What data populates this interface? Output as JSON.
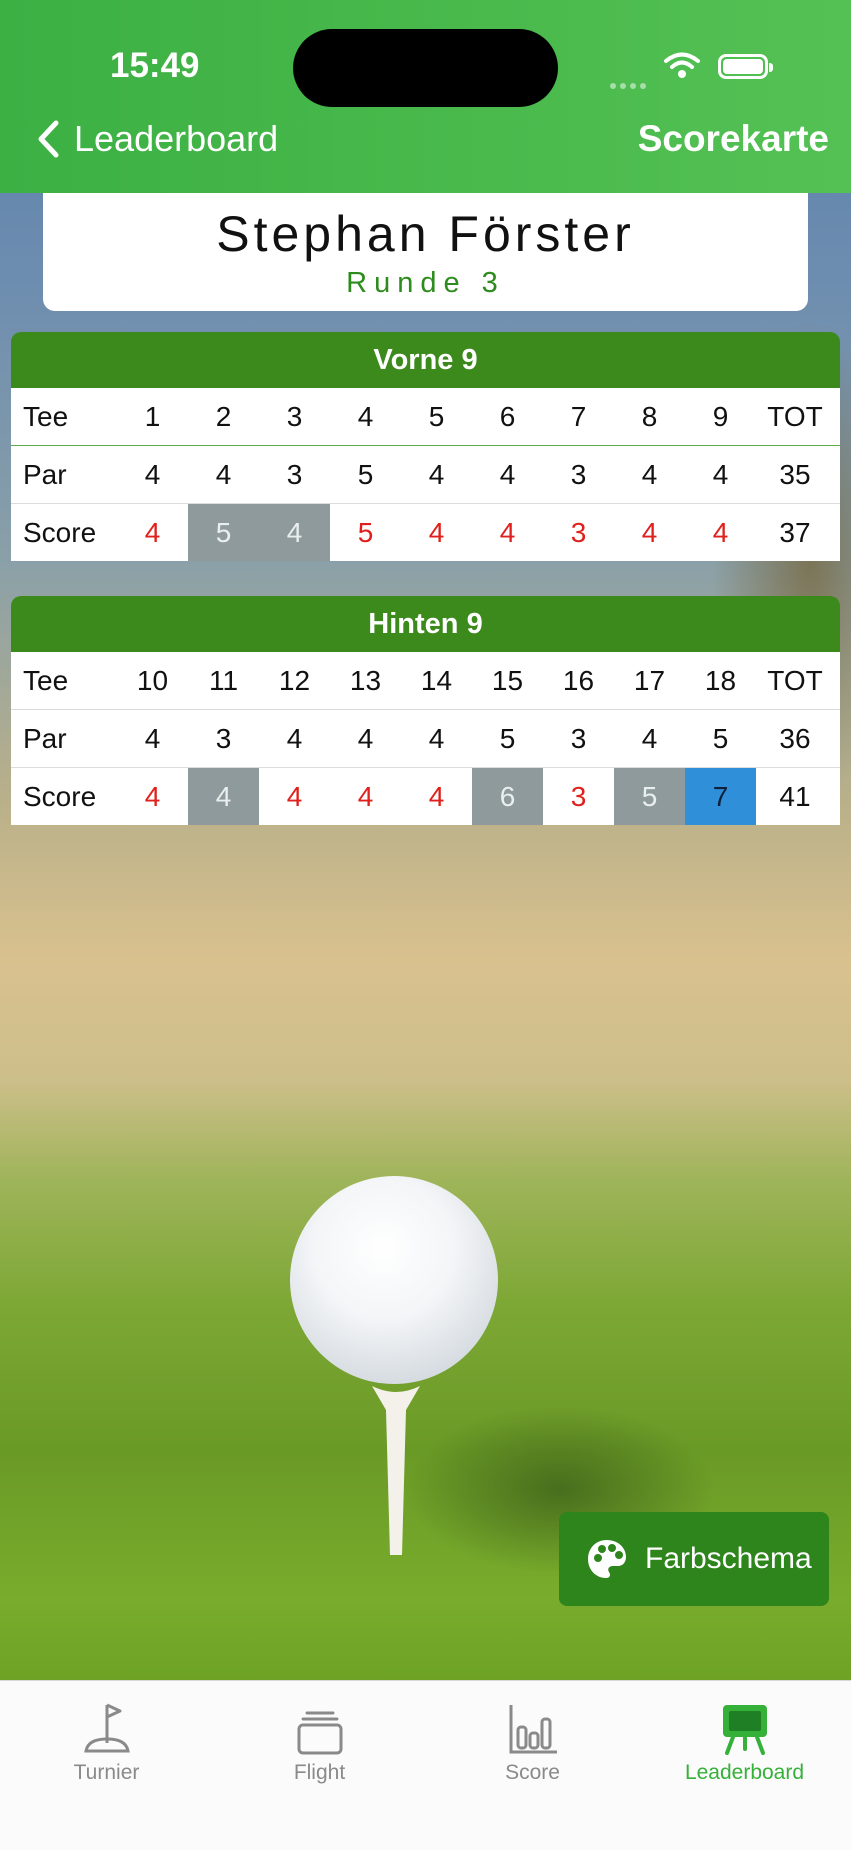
{
  "status": {
    "time": "15:49"
  },
  "nav": {
    "back_label": "Leaderboard",
    "title": "Scorekarte"
  },
  "player": {
    "name": "Stephan Förster",
    "round": "Runde 3"
  },
  "front": {
    "title": "Vorne 9",
    "tee_label": "Tee",
    "par_label": "Par",
    "score_label": "Score",
    "holes": [
      "1",
      "2",
      "3",
      "4",
      "5",
      "6",
      "7",
      "8",
      "9"
    ],
    "par": [
      "4",
      "4",
      "3",
      "5",
      "4",
      "4",
      "3",
      "4",
      "4"
    ],
    "score": [
      "4",
      "5",
      "4",
      "5",
      "4",
      "4",
      "3",
      "4",
      "4"
    ],
    "score_style": [
      "red",
      "gray",
      "gray",
      "red",
      "red",
      "red",
      "red",
      "red",
      "red"
    ],
    "tot_label": "TOT",
    "par_total": "35",
    "score_total": "37"
  },
  "back": {
    "title": "Hinten 9",
    "tee_label": "Tee",
    "par_label": "Par",
    "score_label": "Score",
    "holes": [
      "10",
      "11",
      "12",
      "13",
      "14",
      "15",
      "16",
      "17",
      "18"
    ],
    "par": [
      "4",
      "3",
      "4",
      "4",
      "4",
      "5",
      "3",
      "4",
      "5"
    ],
    "score": [
      "4",
      "4",
      "4",
      "4",
      "4",
      "6",
      "3",
      "5",
      "7"
    ],
    "score_style": [
      "red",
      "gray",
      "red",
      "red",
      "red",
      "gray",
      "red",
      "gray",
      "blue"
    ],
    "tot_label": "TOT",
    "par_total": "36",
    "score_total": "41"
  },
  "fab": {
    "label": "Farbschema",
    "icon": "palette-icon"
  },
  "tabs": [
    {
      "label": "Turnier",
      "icon": "flag-icon",
      "active": false
    },
    {
      "label": "Flight",
      "icon": "cards-stack-icon",
      "active": false
    },
    {
      "label": "Score",
      "icon": "bar-chart-icon",
      "active": false
    },
    {
      "label": "Leaderboard",
      "icon": "easel-board-icon",
      "active": true
    }
  ],
  "colors": {
    "header_green": "#3cb043",
    "card_green": "#3c8a1c",
    "score_red": "#e0201c",
    "cell_gray": "#8e9a9c",
    "cell_blue": "#2f8fd9",
    "active_tab": "#35b13a"
  }
}
